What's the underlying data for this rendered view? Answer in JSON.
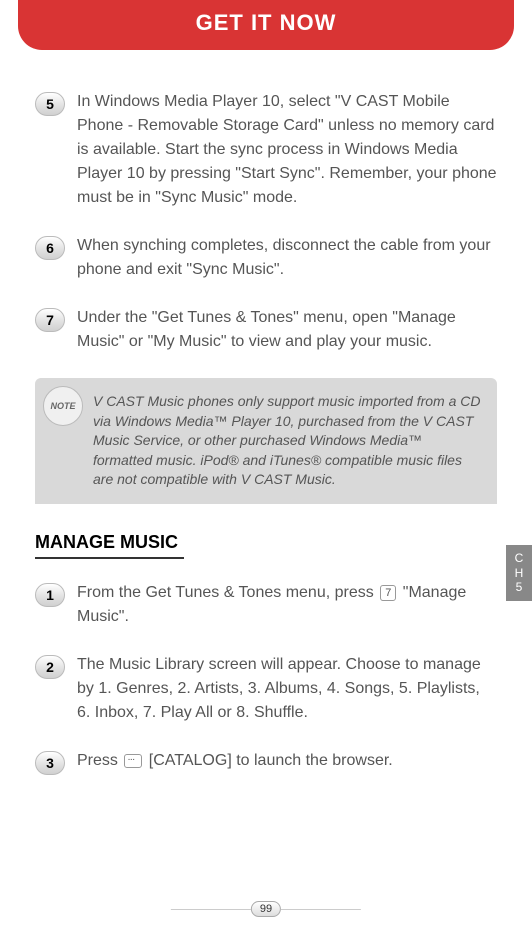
{
  "header": {
    "title": "GET IT NOW"
  },
  "steps_top": [
    {
      "num": "5",
      "text": "In Windows Media Player 10, select \"V CAST Mobile Phone - Removable Storage Card\" unless no memory card is available. Start the sync process in Windows Media Player 10 by pressing \"Start Sync\". Remember, your phone must be in \"Sync Music\" mode."
    },
    {
      "num": "6",
      "text": "When synching completes, disconnect the cable from your phone and exit \"Sync Music\"."
    },
    {
      "num": "7",
      "text": "Under the \"Get Tunes & Tones\" menu, open \"Manage Music\" or \"My Music\" to view and play your music."
    }
  ],
  "note": {
    "label": "NOTE",
    "text": "V CAST Music phones only support music imported from a CD via Windows Media™ Player 10, purchased from the V CAST Music Service, or other purchased Windows Media™ formatted music. iPod® and iTunes® compatible music files are not compatible with V CAST Music."
  },
  "section": {
    "title": "MANAGE MUSIC"
  },
  "steps_bottom": [
    {
      "num": "1",
      "text_before": "From the Get Tunes & Tones menu, press ",
      "key": "7",
      "text_after": " \"Manage Music\"."
    },
    {
      "num": "2",
      "text": "The Music Library screen will appear. Choose to manage by 1. Genres, 2. Artists, 3. Albums, 4. Songs, 5. Playlists, 6. Inbox, 7. Play All or 8. Shuffle."
    },
    {
      "num": "3",
      "text_before": "Press ",
      "text_after": " [CATALOG] to launch the browser."
    }
  ],
  "side_tab": {
    "line1": "C",
    "line2": "H",
    "line3": "5"
  },
  "footer": {
    "page": "99"
  }
}
